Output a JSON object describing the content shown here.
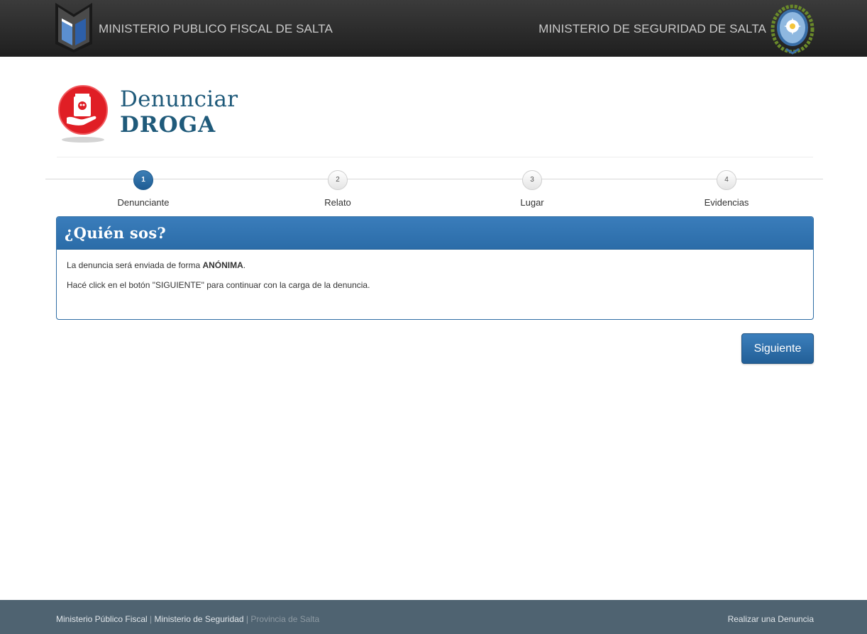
{
  "header": {
    "left_title": "MINISTERIO PUBLICO FISCAL DE SALTA",
    "right_title": "MINISTERIO DE SEGURIDAD DE SALTA"
  },
  "brand": {
    "title_line1": "Denunciar",
    "title_line2": "DROGA",
    "icon": "drug-report-icon"
  },
  "steps": [
    {
      "number": "1",
      "label": "Denunciante",
      "active": true
    },
    {
      "number": "2",
      "label": "Relato",
      "active": false
    },
    {
      "number": "3",
      "label": "Lugar",
      "active": false
    },
    {
      "number": "4",
      "label": "Evidencias",
      "active": false
    }
  ],
  "panel": {
    "title": "¿Quién sos?",
    "line1_prefix": "La denuncia será enviada de forma ",
    "line1_bold": "ANÓNIMA",
    "line1_suffix": ".",
    "line2": "Hacé click en el botón \"SIGUIENTE\" para continuar con la carga de la denuncia."
  },
  "actions": {
    "next_label": "Siguiente"
  },
  "footer": {
    "link1": "Ministerio Público Fiscal",
    "sep": " | ",
    "link2": "Ministerio de Seguridad",
    "link3": "Provincia de Salta",
    "right_link": "Realizar una Denuncia"
  },
  "colors": {
    "header_bg": "#2a2a2a",
    "accent": "#2b6ca8",
    "title_text": "#1f5a7a",
    "badge_red": "#e01e25",
    "footer_bg": "#4f6371"
  }
}
